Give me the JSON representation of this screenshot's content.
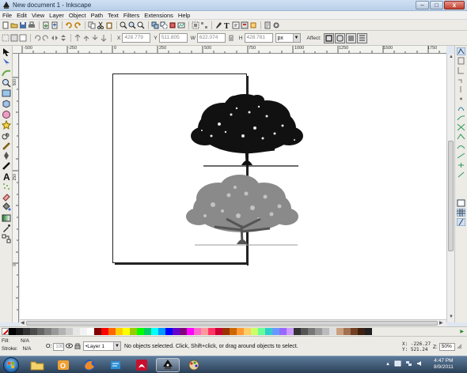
{
  "window": {
    "title": "New document 1 - Inkscape",
    "controls": [
      "–",
      "□",
      "x"
    ]
  },
  "menubar": [
    "File",
    "Edit",
    "View",
    "Layer",
    "Object",
    "Path",
    "Text",
    "Filters",
    "Extensions",
    "Help"
  ],
  "tool_controls": {
    "x_label": "X",
    "x_value": "428.779",
    "y_label": "Y",
    "y_value": "511.805",
    "w_label": "W",
    "w_value": "622.074",
    "h_label": "H",
    "h_value": "428.781",
    "unit": "px",
    "affect_label": "Affect:"
  },
  "ruler_top_labels": [
    "-500",
    "-250",
    "0",
    "250",
    "500",
    "750",
    "1000",
    "1250",
    "1500",
    "1750"
  ],
  "ruler_left_labels": [
    "500",
    "250",
    "0"
  ],
  "palette": [
    "#000000",
    "#1a1a1a",
    "#333333",
    "#4d4d4d",
    "#666666",
    "#808080",
    "#999999",
    "#b3b3b3",
    "#cccccc",
    "#e6e6e6",
    "#f2f2f2",
    "#ffffff",
    "#800000",
    "#ff0000",
    "#ff6600",
    "#ffcc00",
    "#ffff00",
    "#99cc00",
    "#00ff00",
    "#00cc66",
    "#00ffff",
    "#0099ff",
    "#0000ff",
    "#6600cc",
    "#800080",
    "#ff00ff",
    "#ff66cc",
    "#ff9999",
    "#ff3366",
    "#cc0033",
    "#993300",
    "#cc6600",
    "#ff9933",
    "#ffcc66",
    "#ccff66",
    "#66ff99",
    "#33cccc",
    "#6699ff",
    "#9966ff",
    "#cc99ff",
    "#333333",
    "#555555",
    "#777777",
    "#999999",
    "#bbbbbb",
    "#dddddd",
    "#c8a080",
    "#a07050",
    "#704020",
    "#402010",
    "#202020"
  ],
  "status": {
    "fill_label": "Fill:",
    "fill_value": "N/A",
    "stroke_label": "Stroke:",
    "stroke_value": "N/A",
    "opacity_label": "O:",
    "opacity_value": "100",
    "layer": "•Layer 1",
    "message": "No objects selected. Click, Shift+click, or drag around objects to select.",
    "x_coord": "X: -226.27",
    "y_coord": "Y:  521.24",
    "zoom_label": "Z:",
    "zoom_value": "50%"
  },
  "taskbar": {
    "time": "4:47 PM",
    "date": "8/9/2011"
  }
}
